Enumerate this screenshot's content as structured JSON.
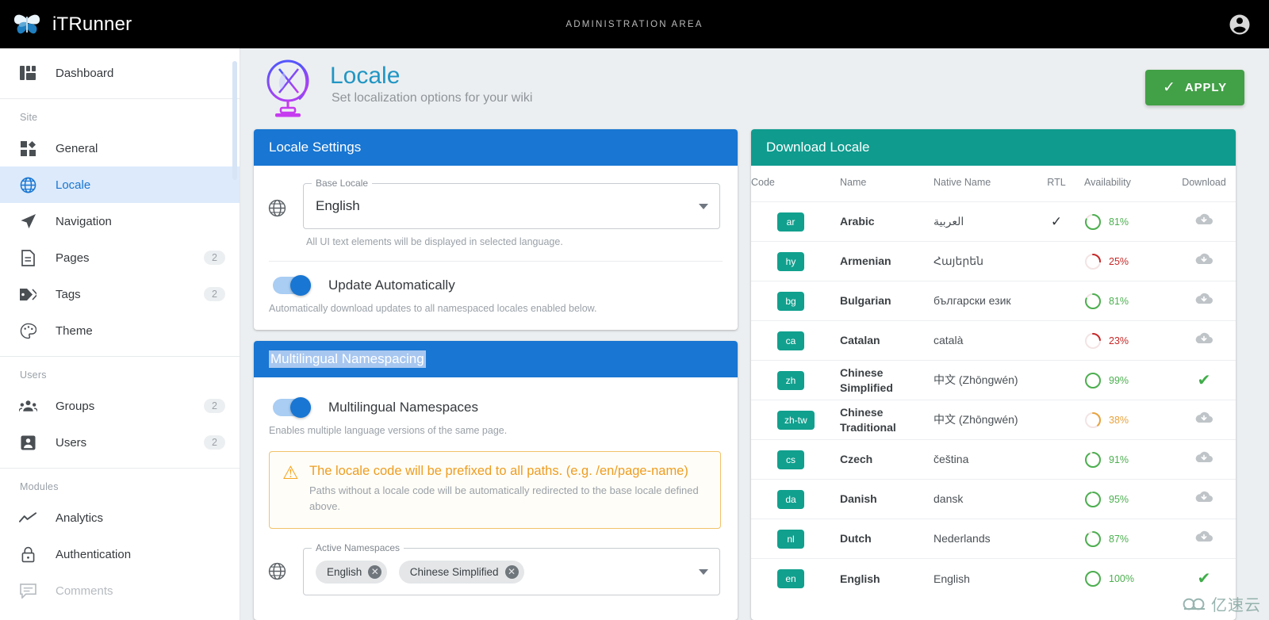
{
  "topbar": {
    "brand": "iTRunner",
    "center_label": "ADMINISTRATION AREA",
    "account_icon": "account-circle-icon"
  },
  "sidebar": {
    "dashboard": {
      "label": "Dashboard",
      "icon": "dashboard-icon"
    },
    "groups": [
      {
        "heading": "Site",
        "items": [
          {
            "label": "General",
            "icon": "general-icon",
            "count": "",
            "active": false,
            "dim": false
          },
          {
            "label": "Locale",
            "icon": "globe-icon",
            "count": "",
            "active": true,
            "dim": false
          },
          {
            "label": "Navigation",
            "icon": "navigation-icon",
            "count": "",
            "active": false,
            "dim": false
          },
          {
            "label": "Pages",
            "icon": "page-icon",
            "count": "2",
            "active": false,
            "dim": false
          },
          {
            "label": "Tags",
            "icon": "tag-icon",
            "count": "2",
            "active": false,
            "dim": false
          },
          {
            "label": "Theme",
            "icon": "palette-icon",
            "count": "",
            "active": false,
            "dim": false
          }
        ]
      },
      {
        "heading": "Users",
        "items": [
          {
            "label": "Groups",
            "icon": "groups-icon",
            "count": "2",
            "active": false,
            "dim": false
          },
          {
            "label": "Users",
            "icon": "account-icon",
            "count": "2",
            "active": false,
            "dim": false
          }
        ]
      },
      {
        "heading": "Modules",
        "items": [
          {
            "label": "Analytics",
            "icon": "chart-line-icon",
            "count": "",
            "active": false,
            "dim": false
          },
          {
            "label": "Authentication",
            "icon": "lock-icon",
            "count": "",
            "active": false,
            "dim": false
          },
          {
            "label": "Comments",
            "icon": "comment-icon",
            "count": "",
            "active": false,
            "dim": true
          }
        ]
      }
    ]
  },
  "page": {
    "icon": "globe-stand-icon",
    "title": "Locale",
    "subtitle": "Set localization options for your wiki",
    "apply_label": "APPLY",
    "apply_icon": "check-icon"
  },
  "locale_settings": {
    "card_title": "Locale Settings",
    "base_locale": {
      "legend": "Base Locale",
      "value": "English",
      "icon": "globe-icon",
      "hint": "All UI text elements will be displayed in selected language."
    },
    "update_automatically": {
      "label": "Update Automatically",
      "hint": "Automatically download updates to all namespaced locales enabled below.",
      "on": true
    }
  },
  "multilingual": {
    "card_title": "Multilingual Namespacing",
    "card_title_selected": true,
    "namespaces_toggle": {
      "label": "Multilingual Namespaces",
      "hint": "Enables multiple language versions of the same page.",
      "on": true
    },
    "warning": {
      "icon": "alert-triangle-icon",
      "title": "The locale code will be prefixed to all paths. (e.g. /en/page-name)",
      "body": "Paths without a locale code will be automatically redirected to the base locale defined above."
    },
    "active_namespaces": {
      "legend": "Active Namespaces",
      "icon": "globe-icon",
      "chips": [
        "English",
        "Chinese Simplified"
      ]
    }
  },
  "download_locale": {
    "card_title": "Download Locale",
    "columns": [
      "Code",
      "Name",
      "Native Name",
      "RTL",
      "Availability",
      "Download"
    ],
    "rows": [
      {
        "code": "ar",
        "name": "Arabic",
        "native": "العربية",
        "rtl": true,
        "availability": "81%",
        "pct": 81,
        "status": "download"
      },
      {
        "code": "hy",
        "name": "Armenian",
        "native": "Հայերեն",
        "rtl": false,
        "availability": "25%",
        "pct": 25,
        "status": "download"
      },
      {
        "code": "bg",
        "name": "Bulgarian",
        "native": "български език",
        "rtl": false,
        "availability": "81%",
        "pct": 81,
        "status": "download"
      },
      {
        "code": "ca",
        "name": "Catalan",
        "native": "català",
        "rtl": false,
        "availability": "23%",
        "pct": 23,
        "status": "download"
      },
      {
        "code": "zh",
        "name": "Chinese Simplified",
        "native": "中文 (Zhōngwén)",
        "rtl": false,
        "availability": "99%",
        "pct": 99,
        "status": "installed"
      },
      {
        "code": "zh-tw",
        "name": "Chinese Traditional",
        "native": "中文 (Zhōngwén)",
        "rtl": false,
        "availability": "38%",
        "pct": 38,
        "status": "download"
      },
      {
        "code": "cs",
        "name": "Czech",
        "native": "čeština",
        "rtl": false,
        "availability": "91%",
        "pct": 91,
        "status": "download"
      },
      {
        "code": "da",
        "name": "Danish",
        "native": "dansk",
        "rtl": false,
        "availability": "95%",
        "pct": 95,
        "status": "download"
      },
      {
        "code": "nl",
        "name": "Dutch",
        "native": "Nederlands",
        "rtl": false,
        "availability": "87%",
        "pct": 87,
        "status": "download"
      },
      {
        "code": "en",
        "name": "English",
        "native": "English",
        "rtl": false,
        "availability": "100%",
        "pct": 100,
        "status": "installed"
      }
    ]
  },
  "watermark": {
    "text": "亿速云",
    "icon": "cloud-icon"
  },
  "colors": {
    "accent_blue": "#1976d2",
    "accent_teal": "#0f9b8e",
    "apply_green": "#42a047",
    "warn_orange": "#ed9d21",
    "avail_green": "#4caf50",
    "avail_red": "#c62828",
    "avail_amber": "#e8a33d",
    "topbar_black": "#000000"
  }
}
